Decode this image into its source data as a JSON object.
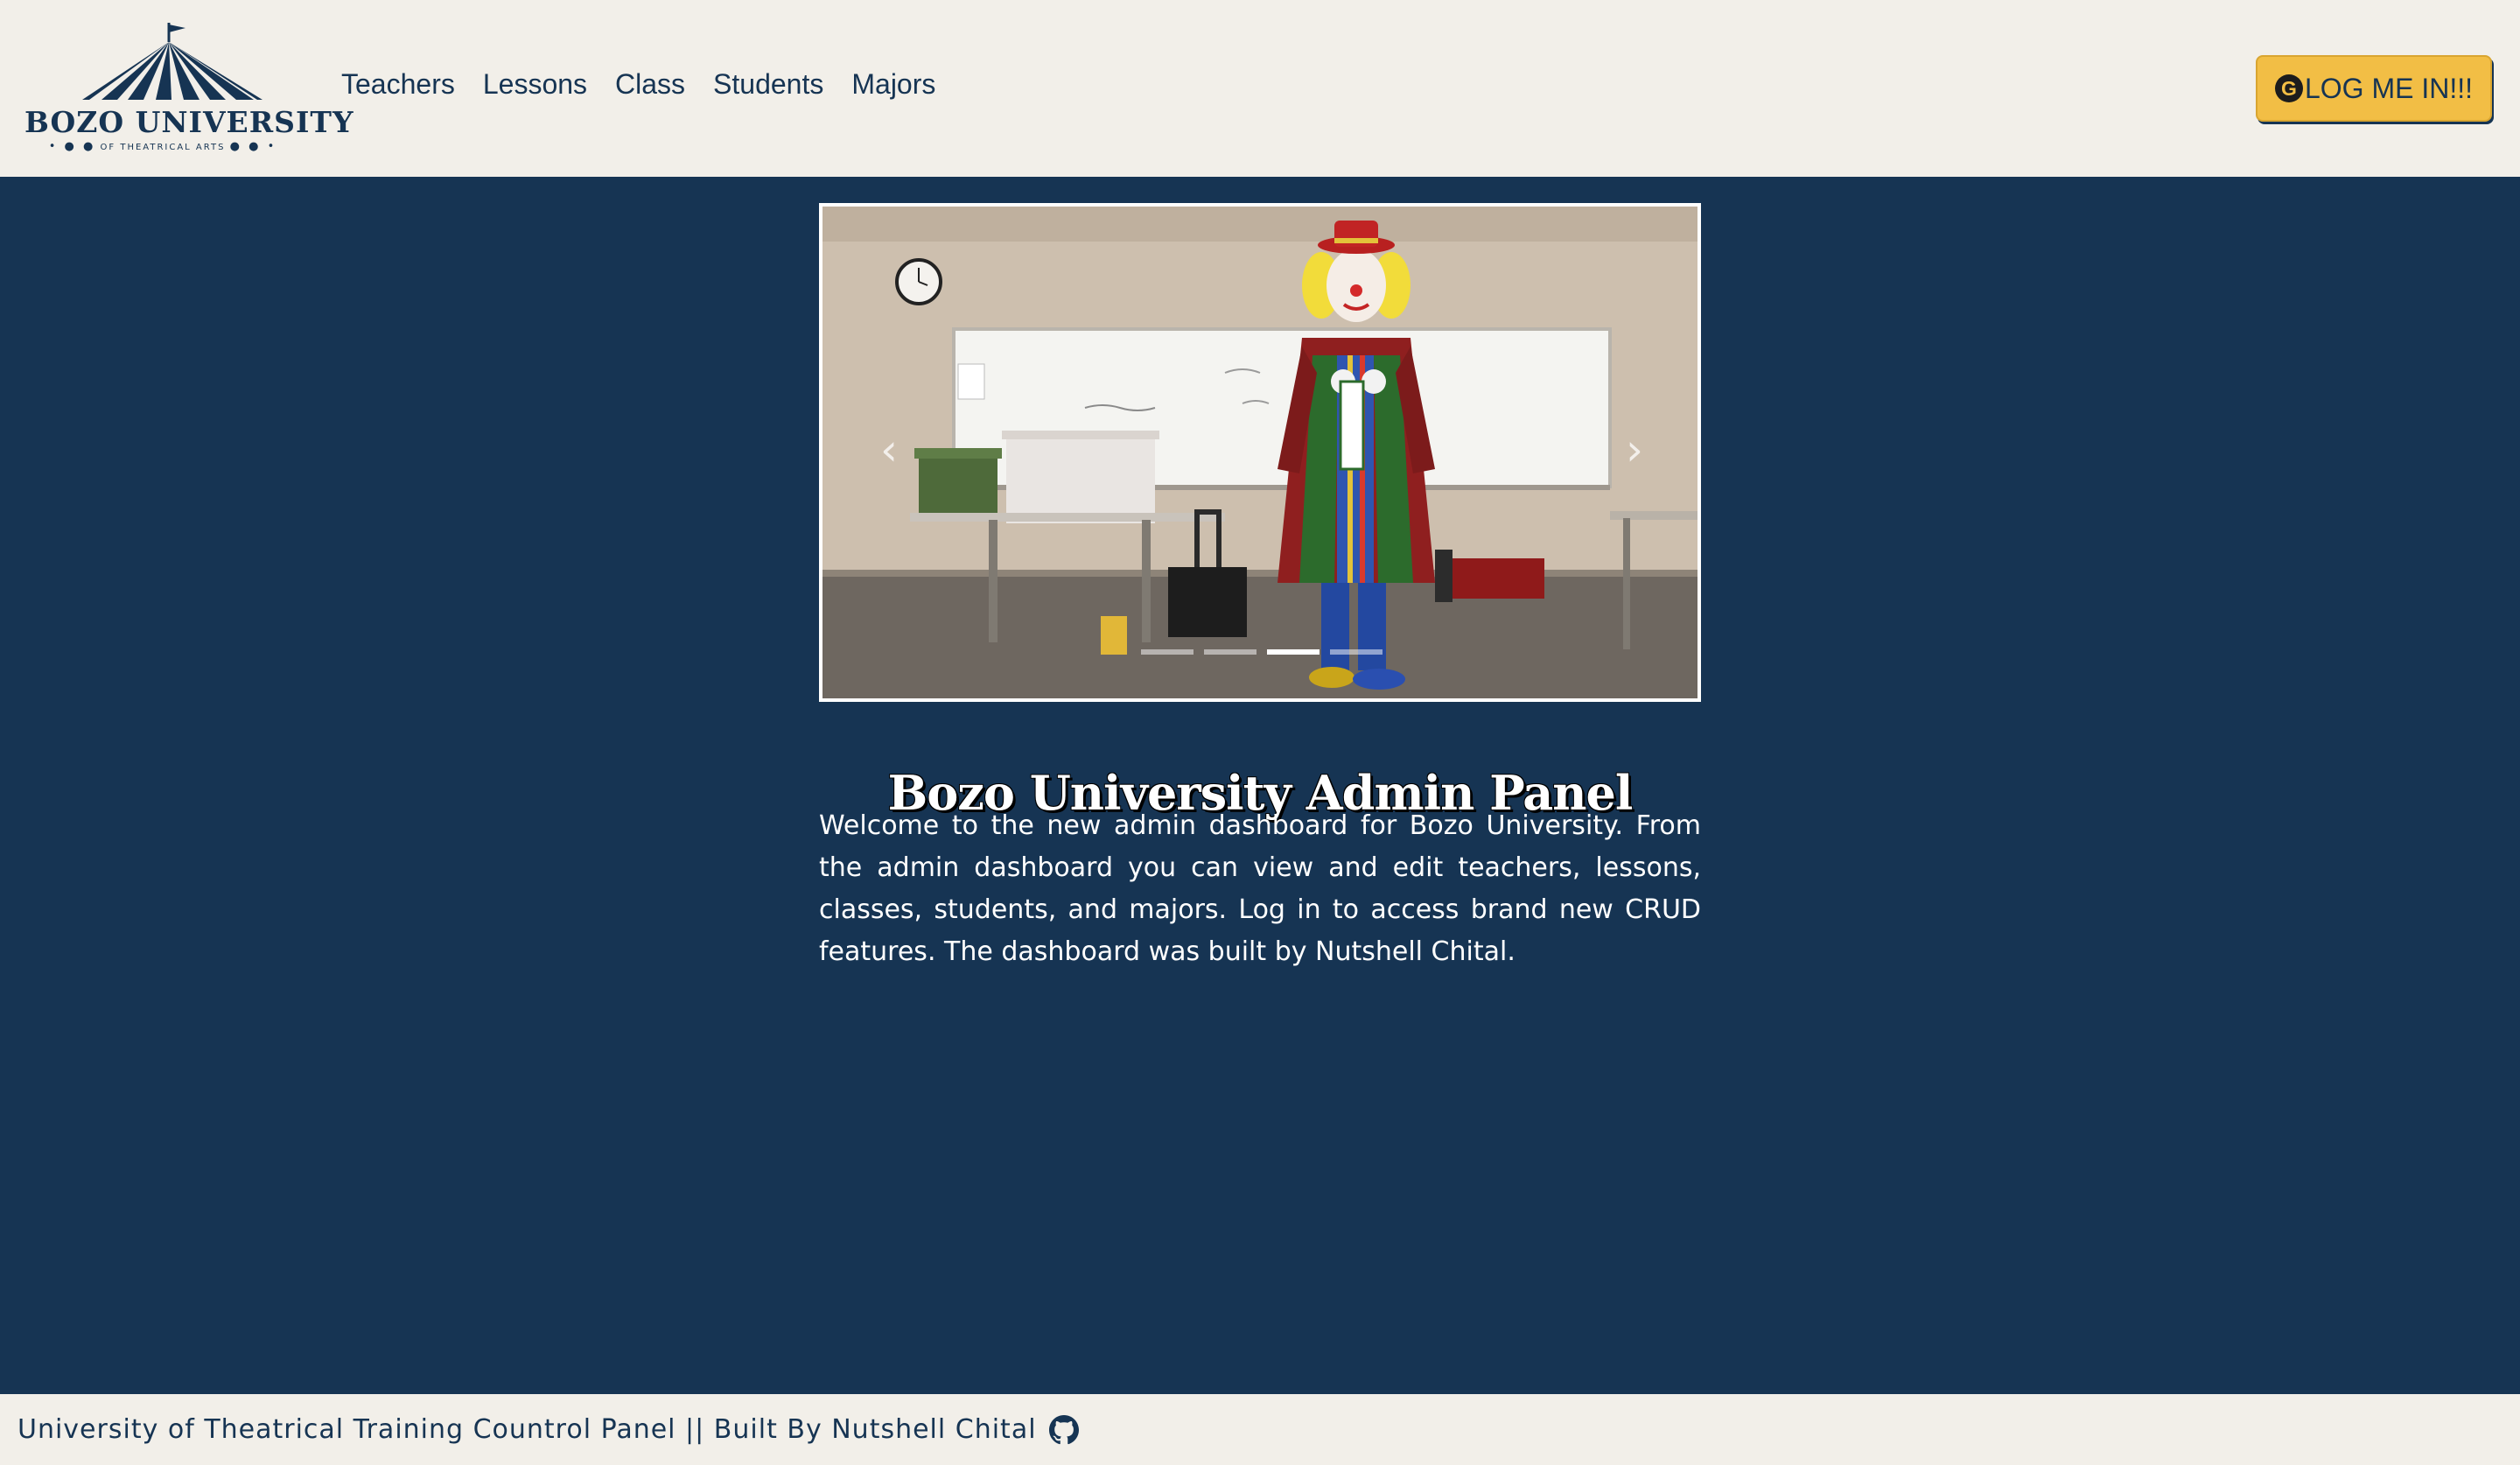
{
  "brand": {
    "name": "BOZO UNIVERSITY",
    "tagline": "OF THEATRICAL ARTS"
  },
  "nav": {
    "items": [
      {
        "label": "Teachers"
      },
      {
        "label": "Lessons"
      },
      {
        "label": "Class"
      },
      {
        "label": "Students"
      },
      {
        "label": "Majors"
      }
    ]
  },
  "login": {
    "icon": "google-icon",
    "icon_glyph": "G",
    "label": "LOG ME IN!!!"
  },
  "carousel": {
    "slide_count": 4,
    "active_index": 2,
    "prev_glyph": "‹",
    "next_glyph": "›"
  },
  "main": {
    "title": "Bozo University Admin Panel",
    "intro": "Welcome to the new admin dashboard for Bozo University. From the admin dashboard you can view and edit teachers, lessons, classes, students, and majors. Log in to access brand new CRUD features. The dashboard was built by Nutshell Chital."
  },
  "footer": {
    "text": "University of Theatrical Training Countrol Panel || Built By Nutshell Chital",
    "icon": "github-icon"
  },
  "colors": {
    "navy": "#163453",
    "cream": "#f2efe9",
    "accent": "#f2be45"
  }
}
